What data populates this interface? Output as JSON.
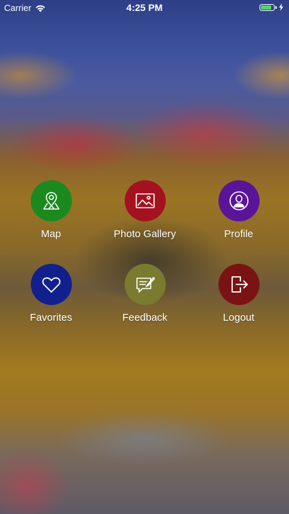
{
  "status_bar": {
    "carrier": "Carrier",
    "time": "4:25 PM",
    "battery_level_percent": 85,
    "battery_color": "#4cd964"
  },
  "menu": {
    "rows": [
      [
        {
          "label": "Map",
          "icon": "map-pin-icon",
          "color": "#1a8a1f"
        },
        {
          "label": "Photo Gallery",
          "icon": "image-icon",
          "color": "#a41220"
        },
        {
          "label": "Profile",
          "icon": "user-icon",
          "color": "#5a149a"
        }
      ],
      [
        {
          "label": "Favorites",
          "icon": "heart-icon",
          "color": "#12208e"
        },
        {
          "label": "Feedback",
          "icon": "feedback-icon",
          "color": "#7b7b2f"
        },
        {
          "label": "Logout",
          "icon": "logout-icon",
          "color": "#7a1414"
        }
      ]
    ]
  }
}
